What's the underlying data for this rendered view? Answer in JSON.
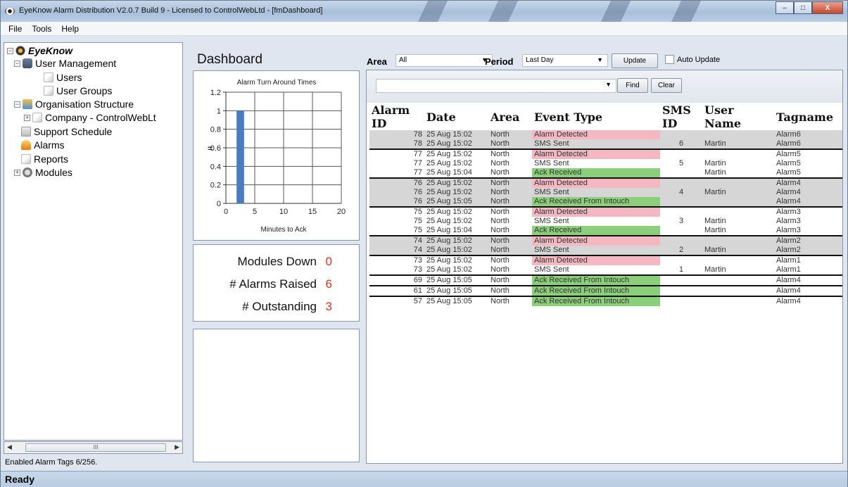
{
  "window": {
    "title": "EyeKnow Alarm Distribution V2.0.7 Build 9 - Licensed to ControlWebLtd - [fmDashboard]",
    "buttons": [
      "–",
      "□",
      "X"
    ]
  },
  "menu": [
    "File",
    "Tools",
    "Help"
  ],
  "tree": {
    "root": "EyeKnow",
    "user_management": "User Management",
    "users": "Users",
    "user_groups": "User Groups",
    "organisation_structure": "Organisation Structure",
    "company": "Company - ControlWebLt",
    "support_schedule": "Support Schedule",
    "alarms": "Alarms",
    "reports": "Reports",
    "modules": "Modules"
  },
  "tree_scroll_thumb": "III",
  "tree_status": "Enabled Alarm Tags 6/256.",
  "dashboard": {
    "title": "Dashboard",
    "modules_down_label": "Modules Down",
    "modules_down_value": "0",
    "alarms_raised_label": "# Alarms Raised",
    "alarms_raised_value": "6",
    "outstanding_label": "# Outstanding",
    "outstanding_value": "3"
  },
  "chart_data": {
    "type": "bar",
    "title": "Alarm Turn Around Times",
    "xlabel": "Minutes to Ack",
    "ylabel": "",
    "legend_marker": "=",
    "x": [
      2.5
    ],
    "values": [
      1
    ],
    "xlim": [
      0,
      20
    ],
    "ylim": [
      0,
      1.2
    ],
    "xticks": [
      "0",
      "5",
      "10",
      "15",
      "20"
    ],
    "yticks": [
      "0",
      "0.2",
      "0.4",
      "0.6",
      "0.8",
      "1",
      "1.2"
    ],
    "bar_color": "#4a7cc0",
    "grid": true
  },
  "filters": {
    "area_label": "Area",
    "area_value": "All",
    "period_label": "Period",
    "period_value": "Last Day",
    "update_button": "Update",
    "auto_update_label": "Auto Update",
    "find_button": "Find",
    "clear_button": "Clear"
  },
  "grid": {
    "columns": [
      "Alarm ID",
      "Date",
      "Area",
      "Event Type",
      "SMS ID",
      "User Name",
      "Tagname"
    ],
    "rows": [
      {
        "id": "78",
        "date": "25 Aug 15:02",
        "area": "North",
        "event": "Alarm Detected",
        "kind": "alarm",
        "sms": "",
        "user": "",
        "tag": "Alarm6",
        "shaded": true,
        "gend": false
      },
      {
        "id": "78",
        "date": "25 Aug 15:02",
        "area": "North",
        "event": "SMS Sent",
        "kind": "sms",
        "sms": "6",
        "user": "Martin",
        "tag": "Alarm6",
        "shaded": true,
        "gend": true
      },
      {
        "id": "77",
        "date": "25 Aug 15:02",
        "area": "North",
        "event": "Alarm Detected",
        "kind": "alarm",
        "sms": "",
        "user": "",
        "tag": "Alarm5",
        "shaded": false,
        "gend": false
      },
      {
        "id": "77",
        "date": "25 Aug 15:02",
        "area": "North",
        "event": "SMS Sent",
        "kind": "sms",
        "sms": "5",
        "user": "Martin",
        "tag": "Alarm5",
        "shaded": false,
        "gend": false
      },
      {
        "id": "77",
        "date": "25 Aug 15:04",
        "area": "North",
        "event": "Ack Received",
        "kind": "ack",
        "sms": "",
        "user": "Martin",
        "tag": "Alarm5",
        "shaded": false,
        "gend": true
      },
      {
        "id": "76",
        "date": "25 Aug 15:02",
        "area": "North",
        "event": "Alarm Detected",
        "kind": "alarm",
        "sms": "",
        "user": "",
        "tag": "Alarm4",
        "shaded": true,
        "gend": false
      },
      {
        "id": "76",
        "date": "25 Aug 15:02",
        "area": "North",
        "event": "SMS Sent",
        "kind": "sms",
        "sms": "4",
        "user": "Martin",
        "tag": "Alarm4",
        "shaded": true,
        "gend": false
      },
      {
        "id": "76",
        "date": "25 Aug 15:05",
        "area": "North",
        "event": "Ack Received From Intouch",
        "kind": "ack",
        "sms": "",
        "user": "",
        "tag": "Alarm4",
        "shaded": true,
        "gend": true
      },
      {
        "id": "75",
        "date": "25 Aug 15:02",
        "area": "North",
        "event": "Alarm Detected",
        "kind": "alarm",
        "sms": "",
        "user": "",
        "tag": "Alarm3",
        "shaded": false,
        "gend": false
      },
      {
        "id": "75",
        "date": "25 Aug 15:02",
        "area": "North",
        "event": "SMS Sent",
        "kind": "sms",
        "sms": "3",
        "user": "Martin",
        "tag": "Alarm3",
        "shaded": false,
        "gend": false
      },
      {
        "id": "75",
        "date": "25 Aug 15:04",
        "area": "North",
        "event": "Ack Received",
        "kind": "ack",
        "sms": "",
        "user": "Martin",
        "tag": "Alarm3",
        "shaded": false,
        "gend": true
      },
      {
        "id": "74",
        "date": "25 Aug 15:02",
        "area": "North",
        "event": "Alarm Detected",
        "kind": "alarm",
        "sms": "",
        "user": "",
        "tag": "Alarm2",
        "shaded": true,
        "gend": false
      },
      {
        "id": "74",
        "date": "25 Aug 15:02",
        "area": "North",
        "event": "SMS Sent",
        "kind": "sms",
        "sms": "2",
        "user": "Martin",
        "tag": "Alarm2",
        "shaded": true,
        "gend": true
      },
      {
        "id": "73",
        "date": "25 Aug 15:02",
        "area": "North",
        "event": "Alarm Detected",
        "kind": "alarm",
        "sms": "",
        "user": "",
        "tag": "Alarm1",
        "shaded": false,
        "gend": false
      },
      {
        "id": "73",
        "date": "25 Aug 15:02",
        "area": "North",
        "event": "SMS Sent",
        "kind": "sms",
        "sms": "1",
        "user": "Martin",
        "tag": "Alarm1",
        "shaded": false,
        "gend": true
      },
      {
        "id": "69",
        "date": "25 Aug 15:05",
        "area": "North",
        "event": "Ack Received From Intouch",
        "kind": "ack",
        "sms": "",
        "user": "",
        "tag": "Alarm4",
        "shaded": false,
        "gend": true
      },
      {
        "id": "61",
        "date": "25 Aug 15:05",
        "area": "North",
        "event": "Ack Received From Intouch",
        "kind": "ack",
        "sms": "",
        "user": "",
        "tag": "Alarm4",
        "shaded": false,
        "gend": true
      },
      {
        "id": "57",
        "date": "25 Aug 15:05",
        "area": "North",
        "event": "Ack Received From Intouch",
        "kind": "ack",
        "sms": "",
        "user": "",
        "tag": "Alarm4",
        "shaded": false,
        "gend": false
      }
    ]
  },
  "status": "Ready"
}
